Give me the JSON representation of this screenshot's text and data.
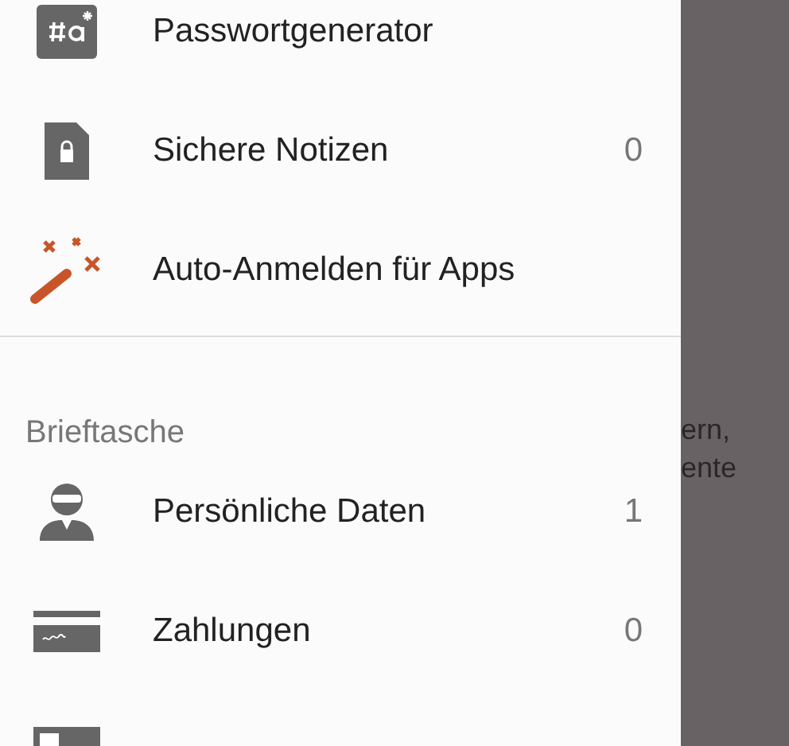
{
  "drawer": {
    "items": [
      {
        "kind": "generator",
        "label": "Passwortgenerator"
      },
      {
        "kind": "note",
        "label": "Sichere Notizen",
        "count": "0"
      },
      {
        "kind": "wand",
        "label": "Auto-Anmelden für Apps"
      }
    ],
    "section": {
      "title": "Brieftasche",
      "items": [
        {
          "kind": "person",
          "label": "Persönliche Daten",
          "count": "1"
        },
        {
          "kind": "card",
          "label": "Zahlungen",
          "count": "0"
        },
        {
          "kind": "id"
        }
      ]
    }
  },
  "background": {
    "lines": [
      "ern,",
      "ente"
    ]
  }
}
